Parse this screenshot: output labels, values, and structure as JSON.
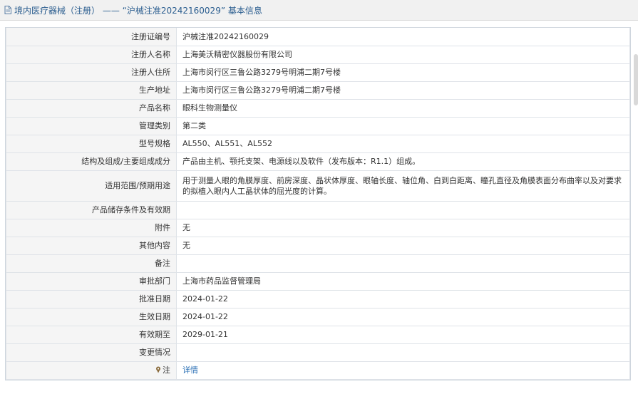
{
  "header": {
    "title": "境内医疗器械（注册） —— “沪械注准20242160029” 基本信息",
    "icon": "document-icon"
  },
  "rows": [
    {
      "label": "注册证编号",
      "value": "沪械注准20242160029"
    },
    {
      "label": "注册人名称",
      "value": "上海美沃精密仪器股份有限公司"
    },
    {
      "label": "注册人住所",
      "value": "上海市闵行区三鲁公路3279号明浦二期7号楼"
    },
    {
      "label": "生产地址",
      "value": "上海市闵行区三鲁公路3279号明浦二期7号楼"
    },
    {
      "label": "产品名称",
      "value": "眼科生物测量仪"
    },
    {
      "label": "管理类别",
      "value": "第二类"
    },
    {
      "label": "型号规格",
      "value": "AL550、AL551、AL552"
    },
    {
      "label": "结构及组成/主要组成成分",
      "value": "产品由主机、颚托支架、电源线以及软件（发布版本：R1.1）组成。"
    },
    {
      "label": "适用范围/预期用途",
      "value": "用于测量人眼的角膜厚度、前房深度、晶状体厚度、眼轴长度、轴位角、白到白距离、瞳孔直径及角膜表面分布曲率以及对要求的拟植入眼内人工晶状体的屈光度的计算。"
    },
    {
      "label": "产品储存条件及有效期",
      "value": ""
    },
    {
      "label": "附件",
      "value": "无"
    },
    {
      "label": "其他内容",
      "value": "无"
    },
    {
      "label": "备注",
      "value": ""
    },
    {
      "label": "审批部门",
      "value": "上海市药品监督管理局"
    },
    {
      "label": "批准日期",
      "value": "2024-01-22"
    },
    {
      "label": "生效日期",
      "value": "2024-01-22"
    },
    {
      "label": "有效期至",
      "value": "2029-01-21"
    },
    {
      "label": "变更情况",
      "value": ""
    }
  ],
  "note": {
    "label": "注",
    "link": "详情",
    "icon": "pin-icon"
  }
}
